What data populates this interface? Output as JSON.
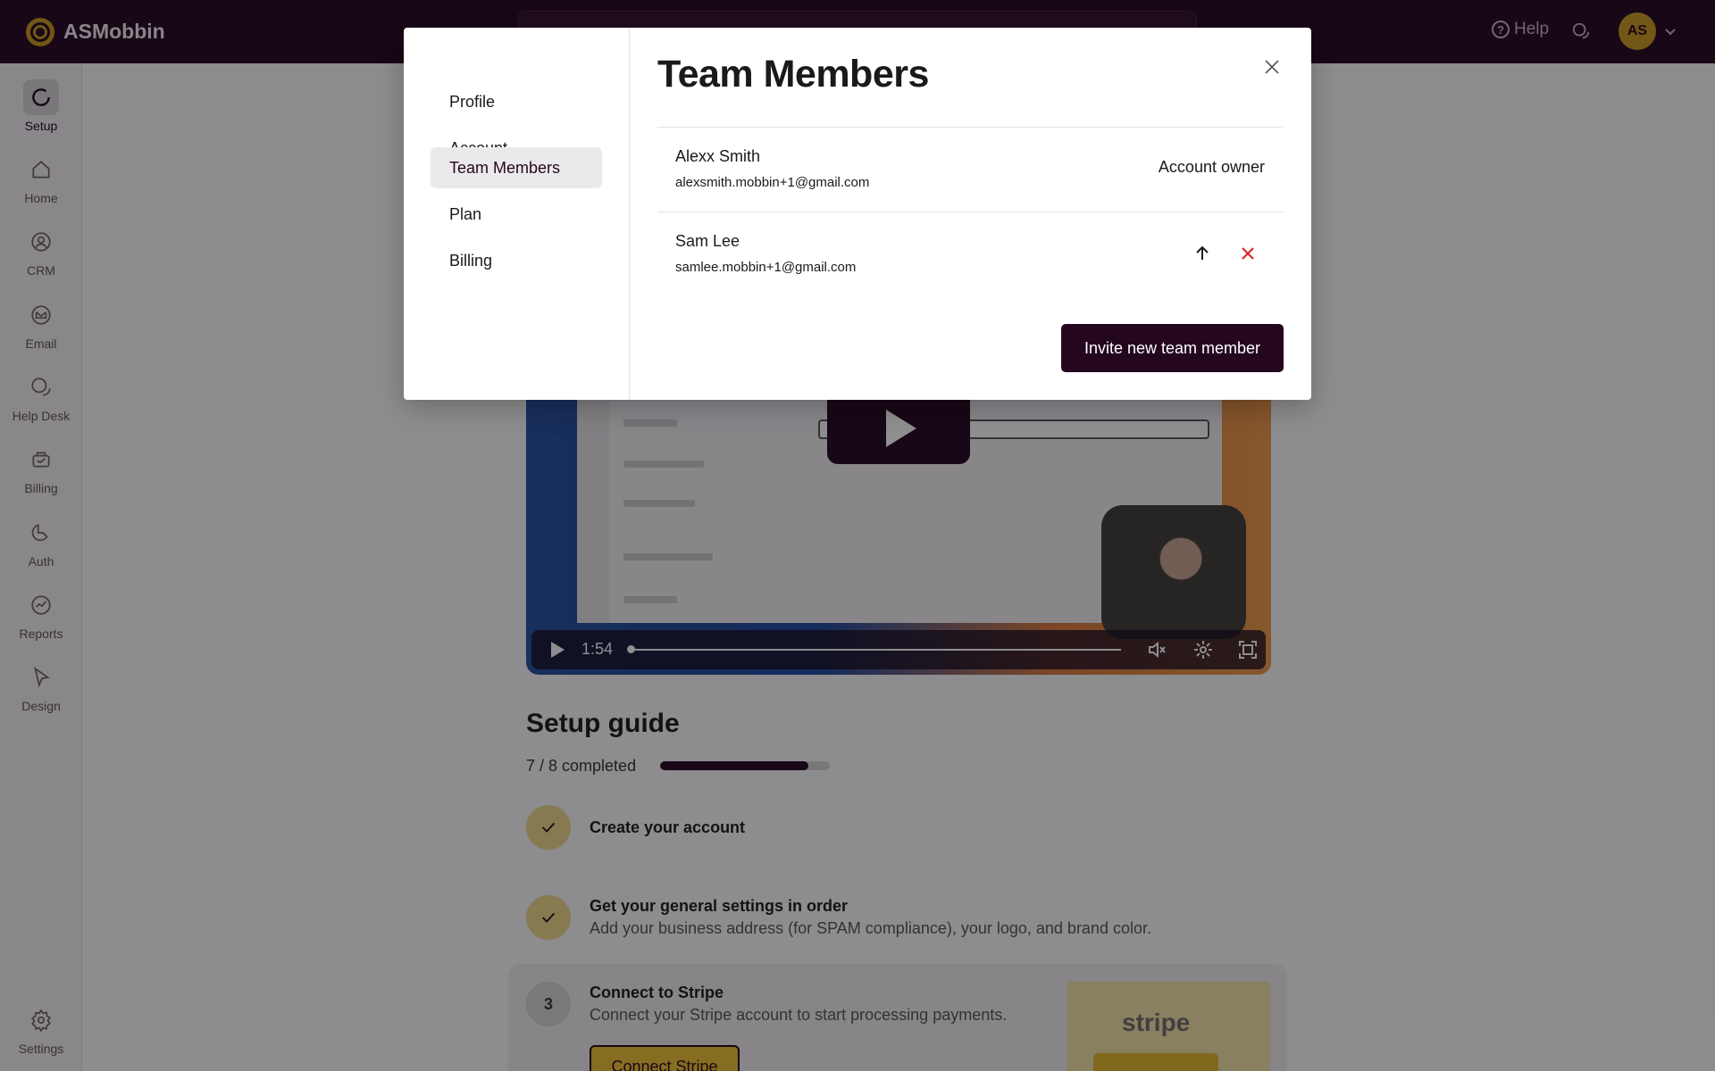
{
  "app": {
    "name": "ASMobbin"
  },
  "header": {
    "help_label": "Help",
    "avatar_initials": "AS"
  },
  "sidebar": {
    "items": [
      {
        "label": "Setup",
        "icon": "setup-icon",
        "active": true
      },
      {
        "label": "Home",
        "icon": "home-icon"
      },
      {
        "label": "CRM",
        "icon": "crm-icon"
      },
      {
        "label": "Email",
        "icon": "email-icon"
      },
      {
        "label": "Help Desk",
        "icon": "help-desk-icon"
      },
      {
        "label": "Billing",
        "icon": "billing-icon"
      },
      {
        "label": "Auth",
        "icon": "auth-icon"
      },
      {
        "label": "Reports",
        "icon": "reports-icon"
      },
      {
        "label": "Design",
        "icon": "design-icon"
      }
    ],
    "settings_label": "Settings"
  },
  "video": {
    "time": "1:54"
  },
  "setup_guide": {
    "title": "Setup guide",
    "progress_text": "7 / 8 completed",
    "progress_fraction": 0.875,
    "steps": [
      {
        "title": "Create your account",
        "done": true
      },
      {
        "title": "Get your general settings in order",
        "desc": "Add your business address (for SPAM compliance), your logo, and brand color.",
        "done": true
      },
      {
        "number": "3",
        "title": "Connect to Stripe",
        "desc": "Connect your Stripe account to start processing payments.",
        "button": "Connect Stripe",
        "image_text": "stripe"
      }
    ]
  },
  "modal": {
    "title": "Team Members",
    "nav": [
      {
        "label": "Profile"
      },
      {
        "label": "Account"
      },
      {
        "label": "Team Members",
        "active": true
      },
      {
        "label": "Plan"
      },
      {
        "label": "Billing"
      }
    ],
    "members": [
      {
        "name": "Alexx Smith",
        "email": "alexsmith.mobbin+1@gmail.com",
        "role": "Account owner"
      },
      {
        "name": "Sam Lee",
        "email": "samlee.mobbin+1@gmail.com"
      }
    ],
    "invite_label": "Invite new team member"
  },
  "colors": {
    "brand_dark": "#24071f",
    "accent_gold": "#c99a1e",
    "danger": "#e0262b"
  }
}
